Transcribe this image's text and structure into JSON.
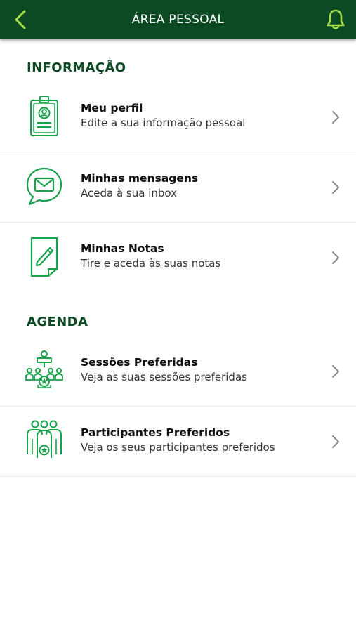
{
  "header": {
    "title": "ÁREA PESSOAL",
    "accent_color": "#a8e04a",
    "bg_color": "#0c4a23"
  },
  "sections": [
    {
      "title": "INFORMAÇÃO",
      "items": [
        {
          "icon": "id-badge-icon",
          "title": "Meu perfil",
          "subtitle": "Edite a sua informação pessoal"
        },
        {
          "icon": "message-bubble-icon",
          "title": "Minhas mensagens",
          "subtitle": "Aceda à sua inbox"
        },
        {
          "icon": "note-pencil-icon",
          "title": "Minhas Notas",
          "subtitle": "Tire e aceda às suas notas"
        }
      ]
    },
    {
      "title": "AGENDA",
      "items": [
        {
          "icon": "session-audience-icon",
          "title": "Sessões Preferidas",
          "subtitle": "Veja as suas sessões preferidas"
        },
        {
          "icon": "participants-star-icon",
          "title": "Participantes Preferidos",
          "subtitle": "Veja os seus participantes preferidos"
        }
      ]
    }
  ],
  "icon_color": "#16a34a"
}
